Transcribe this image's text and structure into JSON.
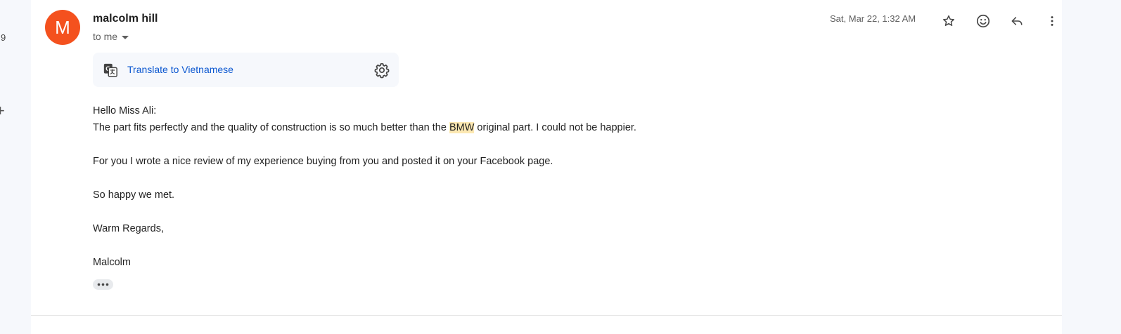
{
  "left_rail": {
    "count": "9",
    "plus_glyph": "+"
  },
  "sender": {
    "initial": "M",
    "name": "malcolm hill",
    "avatar_color": "#f4511e"
  },
  "recipient_label": "to me",
  "date": "Sat, Mar 22, 1:32 AM",
  "icons": [
    "star-icon",
    "emoji-icon",
    "reply-icon",
    "more-vert-icon"
  ],
  "translate": {
    "link_label": "Translate to Vietnamese"
  },
  "body": {
    "greeting": "Hello Miss Ali:",
    "line1_before": "The part fits perfectly and the quality of construction is so much better than the ",
    "line1_highlight": "BMW",
    "line1_after": " original part. I could not be happier.",
    "para2": "For you I wrote a nice review of my experience buying from you and posted it on your Facebook page.",
    "para3": "So happy we met.",
    "closing": "Warm Regards,",
    "signature": "Malcolm"
  },
  "colors": {
    "link": "#0b57d0",
    "highlight": "#fce8b2"
  }
}
